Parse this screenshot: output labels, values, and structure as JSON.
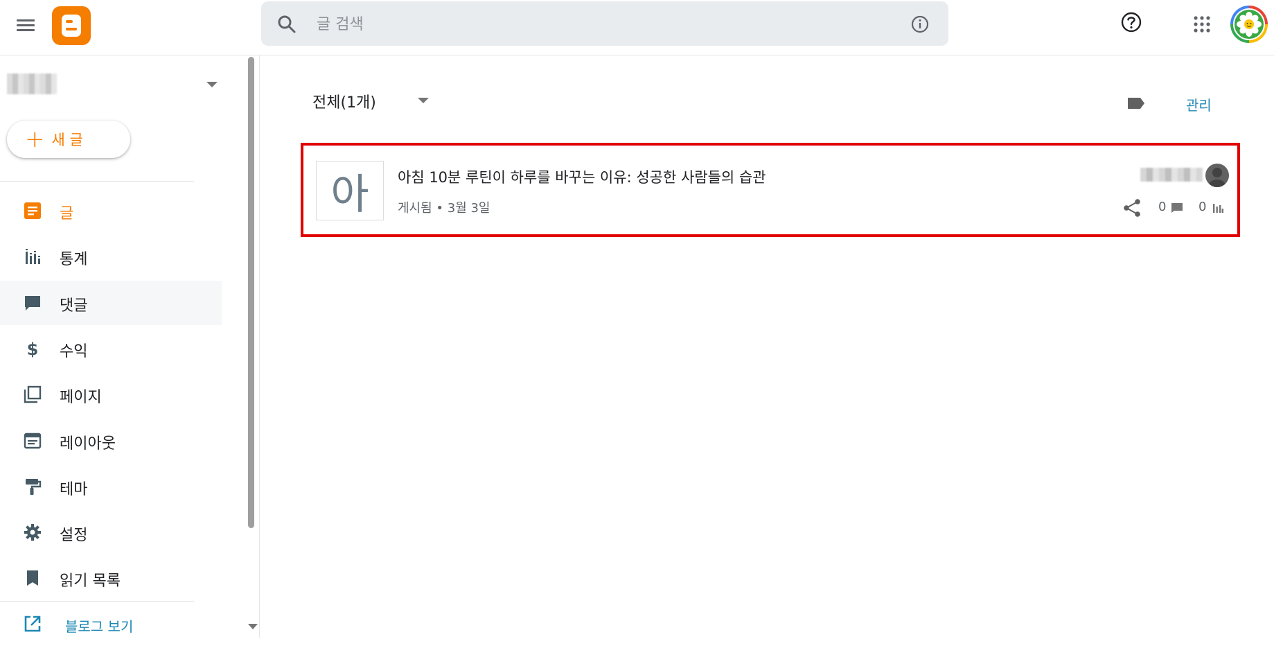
{
  "search": {
    "placeholder": "글 검색"
  },
  "sidebar": {
    "new_post_label": "새 글",
    "items": [
      {
        "id": "posts",
        "label": "글",
        "icon": "posts-icon",
        "active": true
      },
      {
        "id": "stats",
        "label": "통계",
        "icon": "stats-icon"
      },
      {
        "id": "comments",
        "label": "댓글",
        "icon": "comment-icon"
      },
      {
        "id": "earnings",
        "label": "수익",
        "icon": "dollar-icon"
      },
      {
        "id": "pages",
        "label": "페이지",
        "icon": "pages-icon"
      },
      {
        "id": "layout",
        "label": "레이아웃",
        "icon": "layout-icon"
      },
      {
        "id": "theme",
        "label": "테마",
        "icon": "paint-roller-icon"
      },
      {
        "id": "settings",
        "label": "설정",
        "icon": "gear-icon"
      },
      {
        "id": "reading_list",
        "label": "읽기 목록",
        "icon": "bookmark-icon"
      }
    ],
    "view_blog_label": "블로그 보기"
  },
  "main": {
    "filter_label": "전체(1개)",
    "manage_label": "관리",
    "posts": [
      {
        "thumb_char": "아",
        "title": "아침 10분 루틴이 하루를 바꾸는 이유: 성공한 사람들의 습관",
        "meta": "게시됨 • 3월 3일",
        "comments": "0",
        "views": "0"
      }
    ]
  },
  "colors": {
    "brand": "#f57d00",
    "link": "#1e88b4",
    "highlight_border": "#e00000"
  }
}
